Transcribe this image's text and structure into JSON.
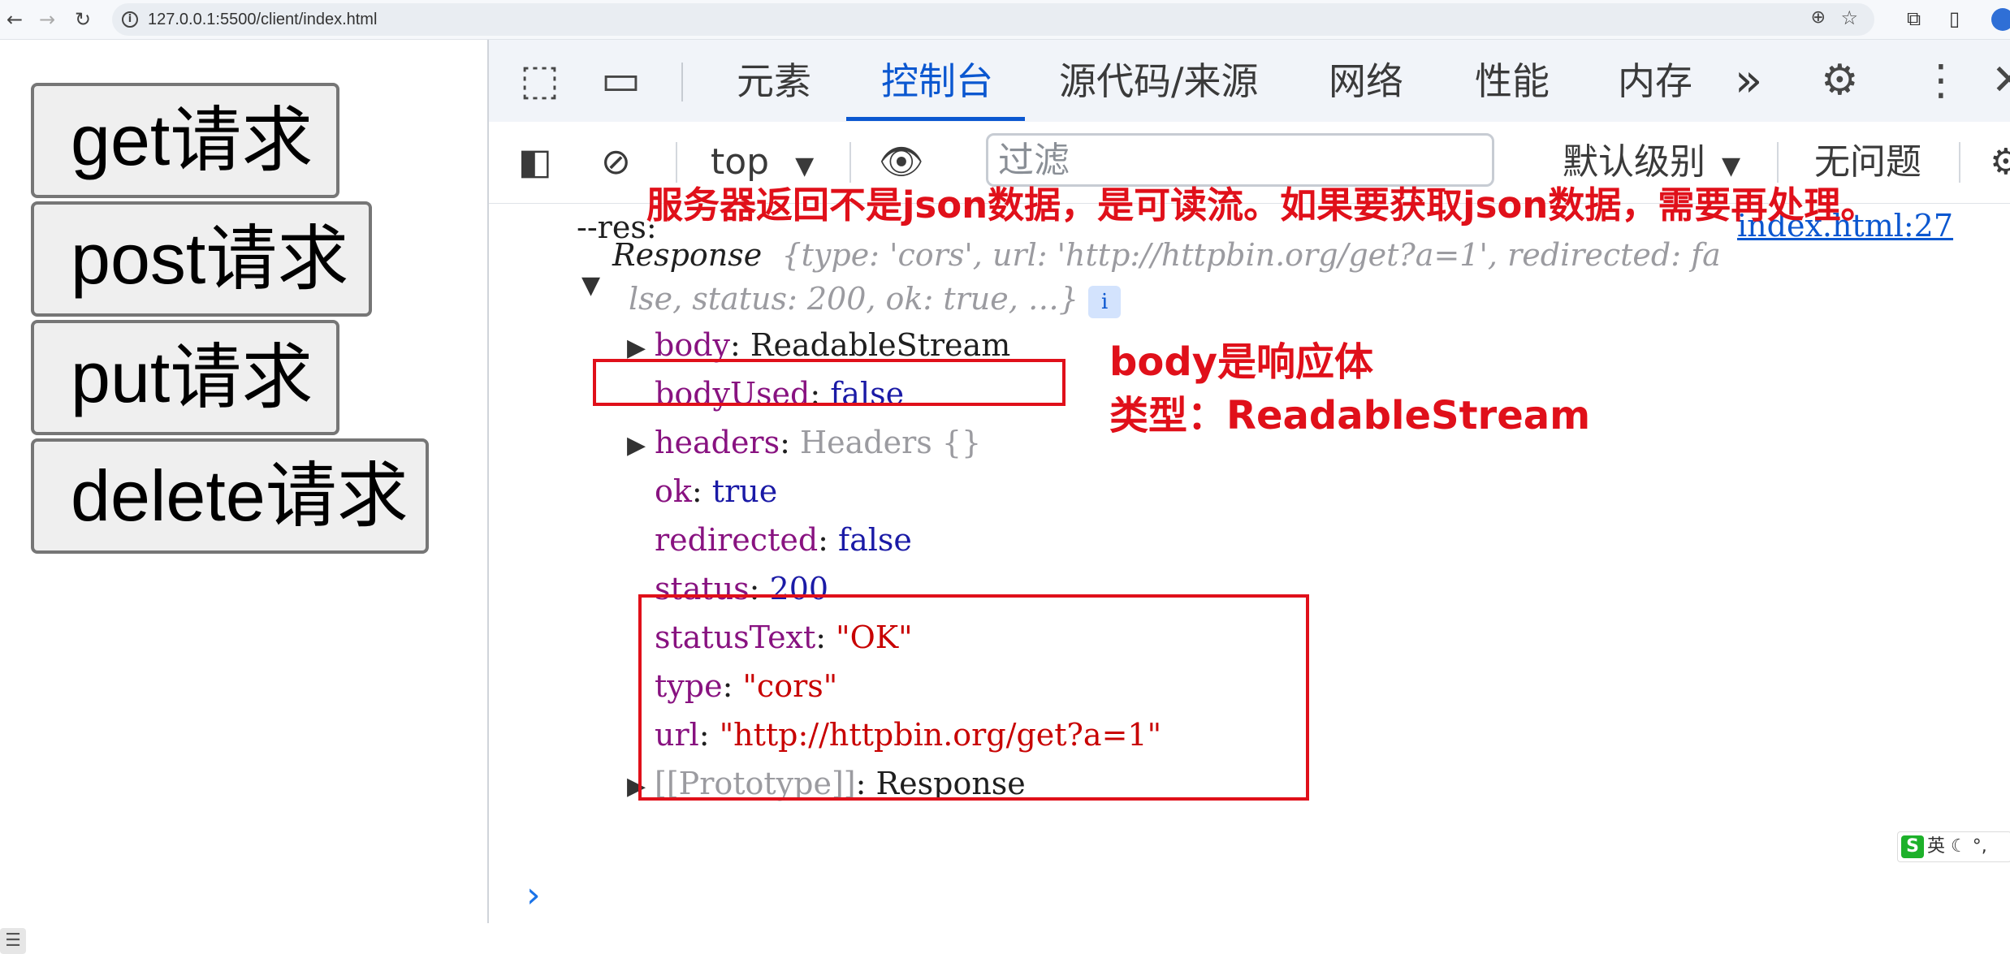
{
  "browser": {
    "url": "127.0.0.1:5500/client/index.html",
    "icons": [
      "back-arrow-icon",
      "forward-arrow-icon",
      "reload-icon",
      "site-info-icon",
      "zoom-icon",
      "bookmark-star-icon",
      "extensions-icon",
      "side-panel-icon",
      "profile-avatar-icon"
    ]
  },
  "page": {
    "buttons": [
      "get请求",
      "post请求",
      "put请求",
      "delete请求"
    ]
  },
  "devtools": {
    "tabs": [
      "元素",
      "控制台",
      "源代码/来源",
      "网络",
      "性能",
      "内存"
    ],
    "active_tab": "控制台",
    "more_tabs_glyph": "»",
    "toolbar": {
      "context": "top",
      "filter_placeholder": "过滤",
      "level": "默认级别",
      "issues": "无问题"
    },
    "console": {
      "log_label": "--res:",
      "source_link": "index.html:27",
      "response_summary_1": "Response",
      "response_summary_1b": "{type: 'cors', url: 'http://httpbin.org/get?a=1', redirected: fa",
      "response_summary_2": "lse, status: 200, ok: true, …}",
      "props": [
        {
          "key": "body",
          "value": "ReadableStream",
          "expandable": true,
          "value_type": "plain"
        },
        {
          "key": "bodyUsed",
          "value": "false",
          "expandable": false,
          "value_type": "bool"
        },
        {
          "key": "headers",
          "value": "Headers  {}",
          "expandable": true,
          "value_type": "dim"
        },
        {
          "key": "ok",
          "value": "true",
          "expandable": false,
          "value_type": "bool"
        },
        {
          "key": "redirected",
          "value": "false",
          "expandable": false,
          "value_type": "bool"
        },
        {
          "key": "status",
          "value": "200",
          "expandable": false,
          "value_type": "num"
        },
        {
          "key": "statusText",
          "value": "\"OK\"",
          "expandable": false,
          "value_type": "str"
        },
        {
          "key": "type",
          "value": "\"cors\"",
          "expandable": false,
          "value_type": "str"
        },
        {
          "key": "url",
          "value": "\"http://httpbin.org/get?a=1\"",
          "expandable": false,
          "value_type": "str"
        }
      ],
      "prototype_key": "[[Prototype]]",
      "prototype_value": "Response",
      "prompt": "›"
    }
  },
  "annotations": {
    "top_note": "服务器返回不是json数据，是可读流。如果要获取json数据，需要再处理。",
    "body_note_1": "body是响应体",
    "body_note_2": "类型：ReadableStream",
    "color": "#e0101a"
  },
  "ime": {
    "label": "英"
  }
}
